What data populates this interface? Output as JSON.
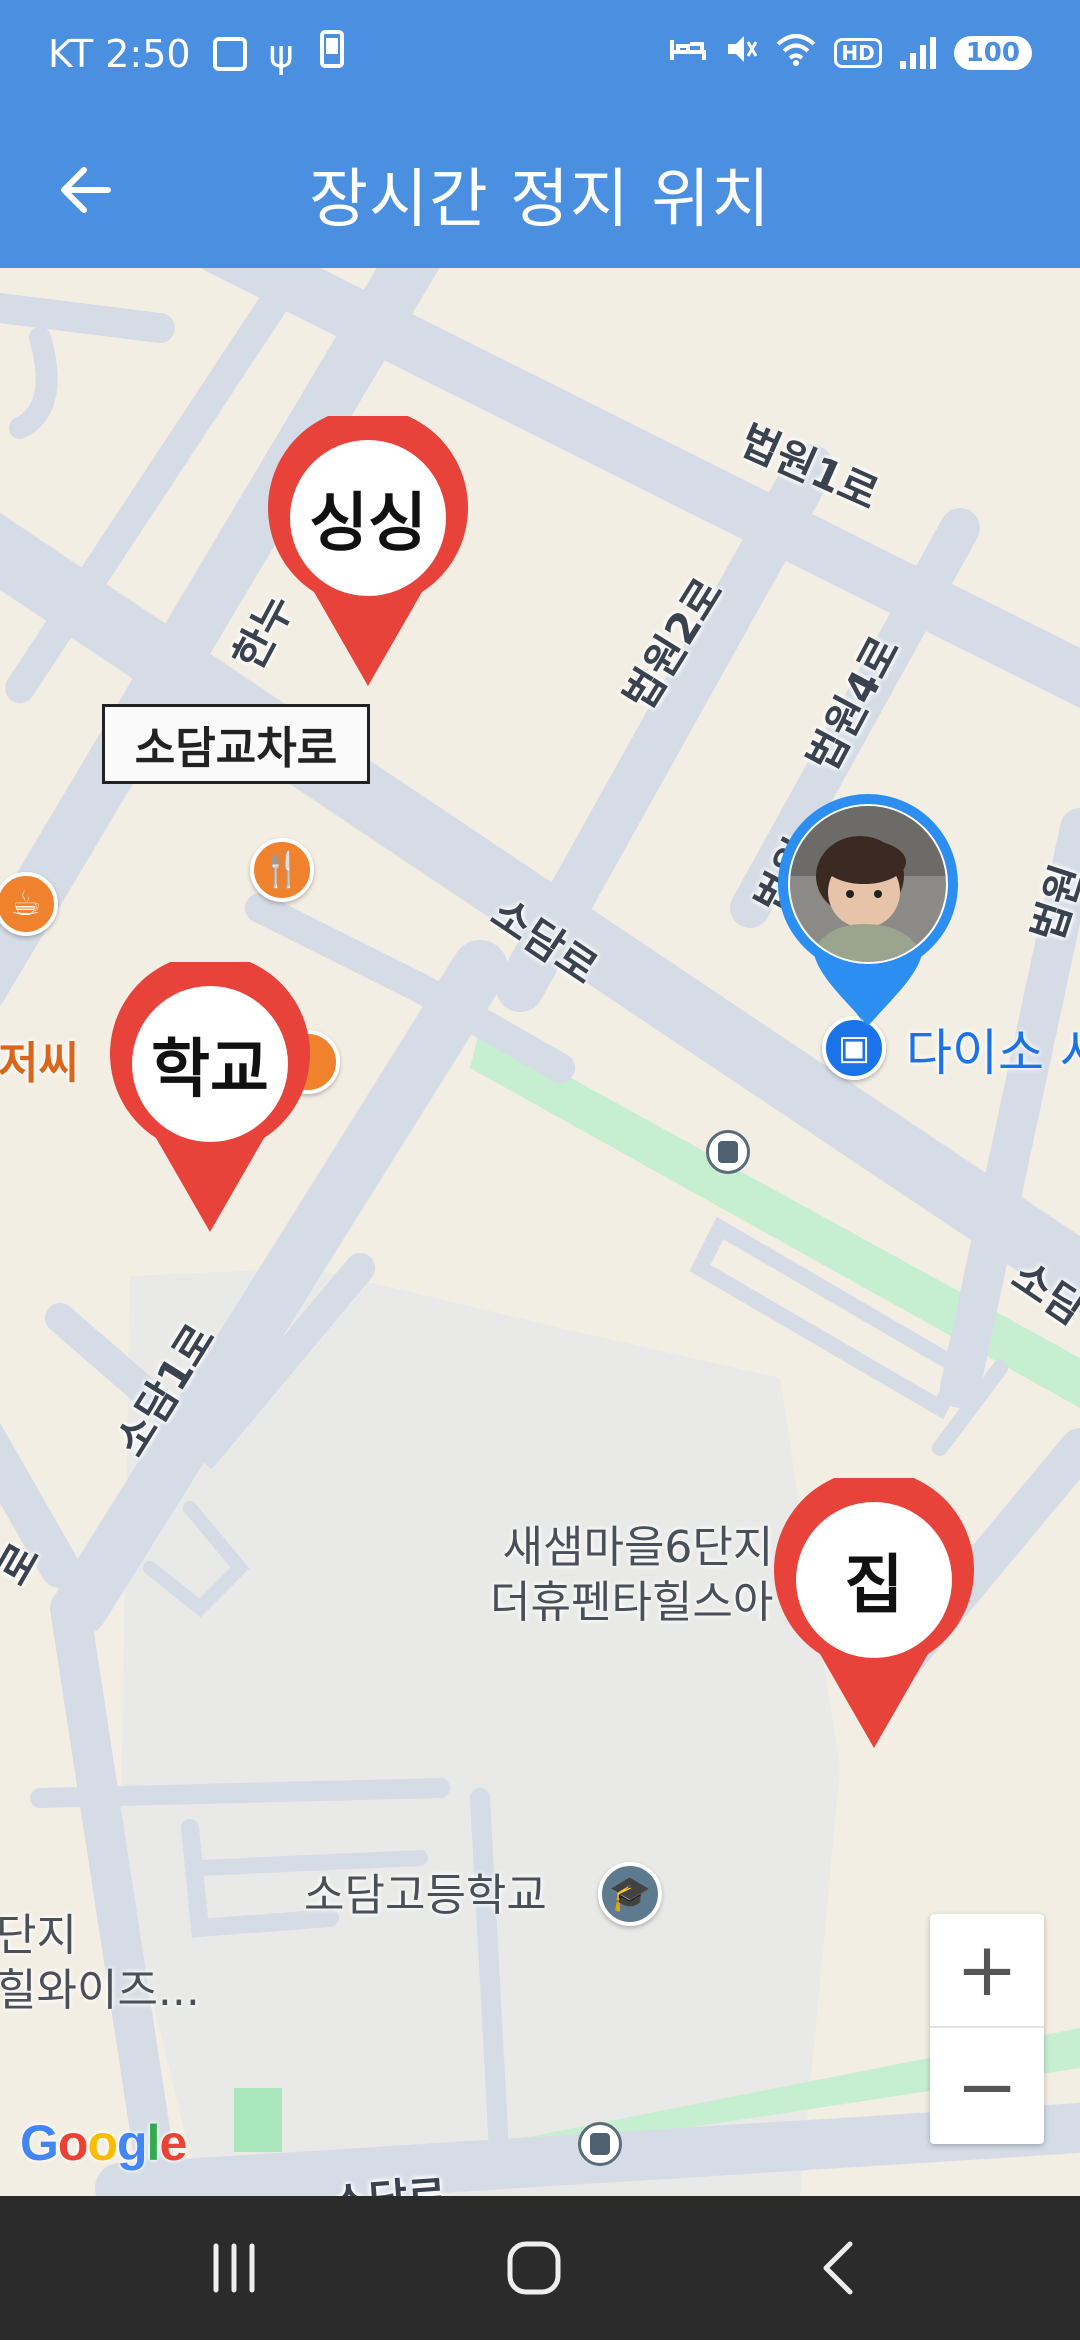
{
  "status_bar": {
    "carrier_time": "KT 2:50",
    "battery": "100",
    "hd_badge": "HD",
    "icons": [
      "screenshot-icon",
      "usb-icon",
      "phone-icon",
      "alarm-icon",
      "mute-icon",
      "wifi-icon",
      "hd-icon",
      "signal-icon",
      "battery-icon"
    ]
  },
  "app_bar": {
    "title": "장시간 정지 위치",
    "back_icon": "arrow-left-icon"
  },
  "map": {
    "intersection_label": "소담교차로",
    "road_labels": {
      "beobwon1": "법원1로",
      "beobwon2": "법원2로",
      "beobwon4": "법원4로",
      "beobwon_partial": "법원",
      "sodamro": "소담로",
      "sodam1ro": "소담1로",
      "han": "한누",
      "sodam_partial": "소담",
      "left_partial": "로",
      "bottom_partial": "소담로"
    },
    "places": {
      "poi_left": "저씨",
      "daiso": "다이소 사",
      "apartment_line1": "새샘마을6단지",
      "apartment_line2": "더휴펜타힐스아",
      "school": "소담고등학교",
      "left_line1": "단지",
      "left_line2": "힐와이즈..."
    },
    "pins": [
      {
        "label": "싱싱",
        "color": "#e8433a"
      },
      {
        "label": "학교",
        "color": "#e8433a"
      },
      {
        "label": "집",
        "color": "#e8433a"
      }
    ],
    "avatar_color": "#2c8ef0",
    "zoom_in": "+",
    "zoom_out": "−",
    "attribution": [
      "G",
      "o",
      "o",
      "g",
      "l",
      "e"
    ],
    "attribution_colors": [
      "#4285f4",
      "#ea4335",
      "#fbbc05",
      "#4285f4",
      "#34a853",
      "#ea4335"
    ]
  },
  "nav_bar": {
    "recents_icon": "recents-icon",
    "home_icon": "home-icon",
    "back_icon": "back-chevron-icon"
  }
}
